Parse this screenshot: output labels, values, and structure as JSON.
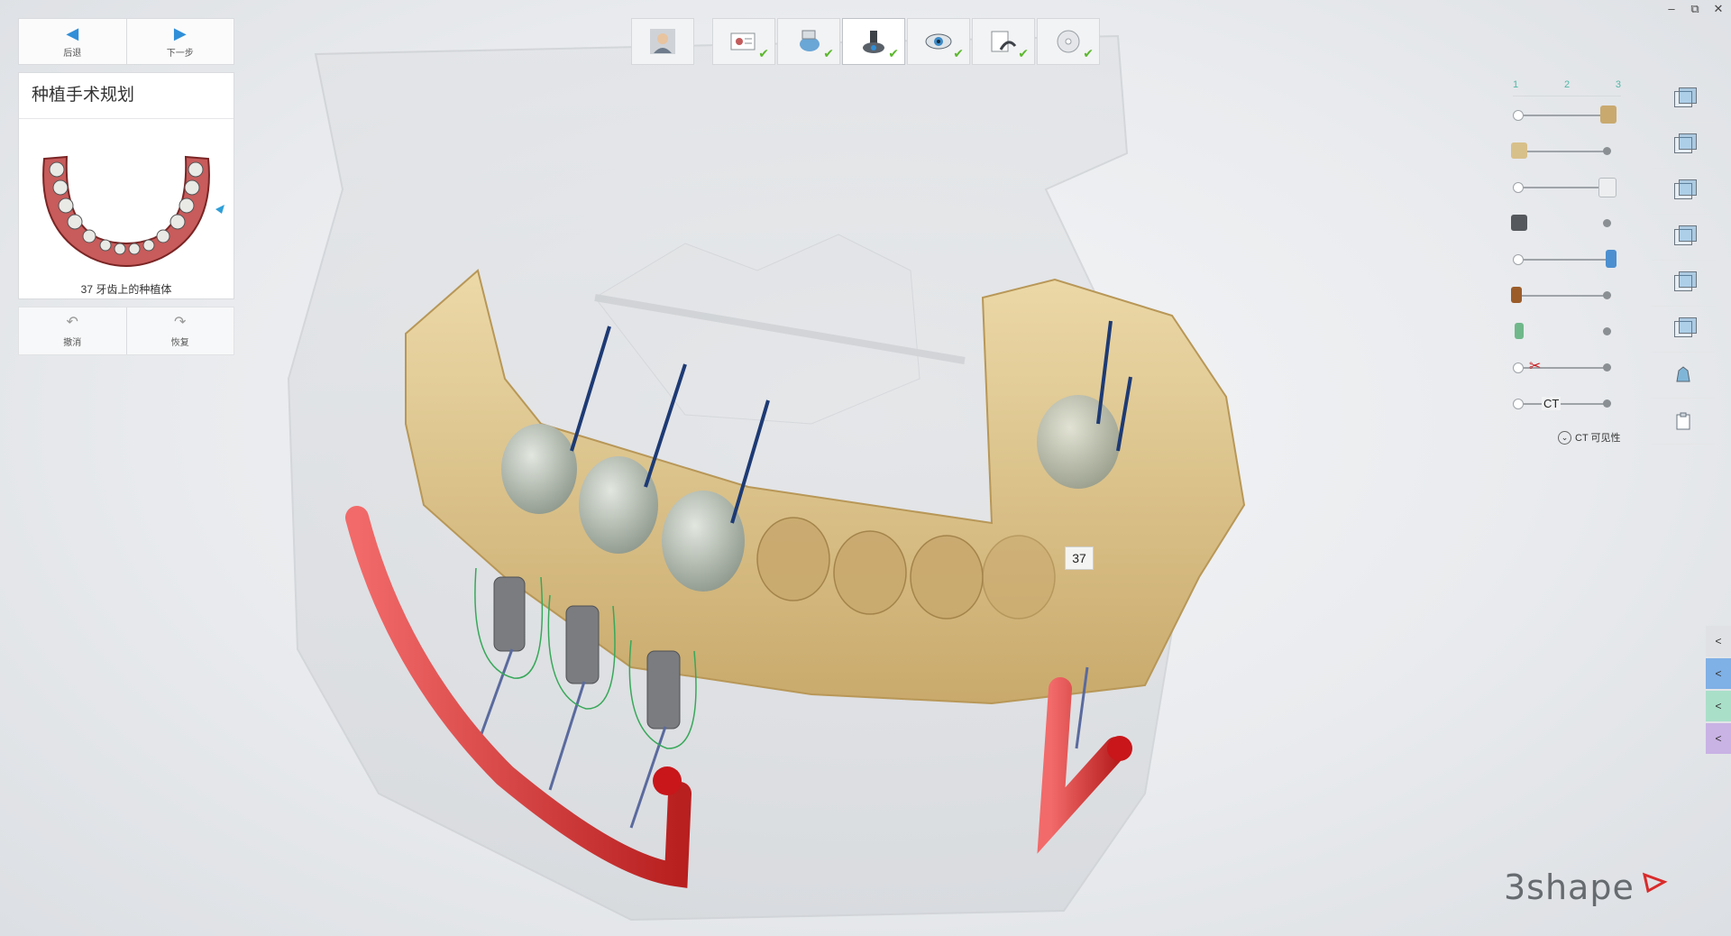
{
  "window": {
    "minimize": "–",
    "maximize": "⧉",
    "close": "✕"
  },
  "nav": {
    "back_label": "后退",
    "next_label": "下一步"
  },
  "panel": {
    "title": "种植手术规划",
    "caption": "37 牙齿上的种植体"
  },
  "history": {
    "undo_label": "撤消",
    "redo_label": "恢复"
  },
  "workflow": {
    "steps": [
      {
        "icon": "patient-photo-icon",
        "completed": false,
        "active": false
      },
      {
        "icon": "patient-info-icon",
        "completed": true,
        "active": false
      },
      {
        "icon": "scan-import-icon",
        "completed": true,
        "active": false
      },
      {
        "icon": "implant-planning-icon",
        "completed": true,
        "active": true
      },
      {
        "icon": "visual-review-icon",
        "completed": true,
        "active": false
      },
      {
        "icon": "guide-design-icon",
        "completed": true,
        "active": false
      },
      {
        "icon": "export-disc-icon",
        "completed": true,
        "active": false
      }
    ]
  },
  "visibility": {
    "tabs": [
      "1",
      "2",
      "3"
    ],
    "ct_label": "CT",
    "ct_visibility_label": "CT 可见性"
  },
  "viewport": {
    "tooth_label": "37"
  },
  "brand": {
    "name": "3shape"
  },
  "colors": {
    "accent": "#2f8fd8",
    "check": "#5cb82e",
    "bone": "#e6cf9b",
    "nerve": "#d83a3a",
    "tab_blue": "#7fb0e6",
    "tab_green": "#a9dfc9",
    "tab_purple": "#c9b2e4"
  }
}
